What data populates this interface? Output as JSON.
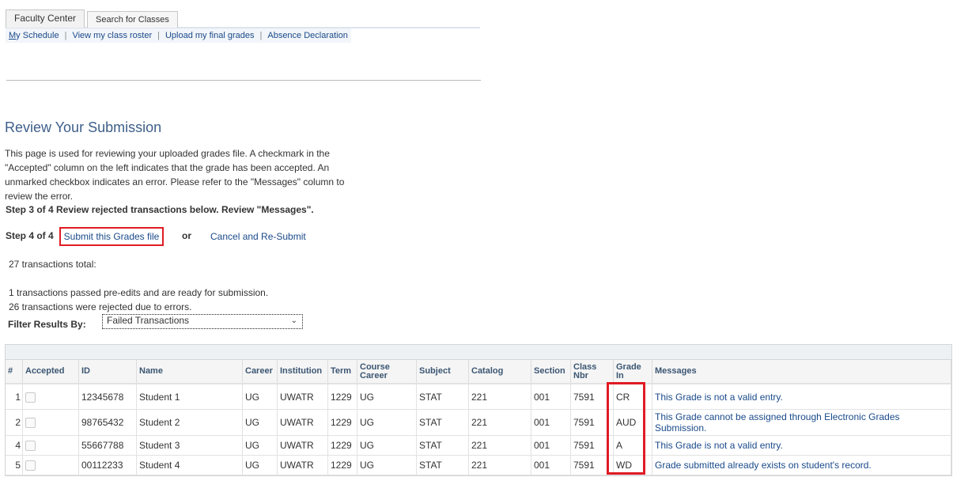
{
  "tabs": [
    {
      "label": "Faculty Center",
      "active": true
    },
    {
      "label": "Search for Classes",
      "active": false
    }
  ],
  "nav": {
    "items": [
      {
        "label_first": "M",
        "label_rest": "y Schedule"
      },
      {
        "label": "View my class roster"
      },
      {
        "label": "Upload my final grades"
      },
      {
        "label": "Absence Declaration"
      }
    ],
    "separator": "|"
  },
  "page": {
    "title": "Review Your Submission",
    "description": "This page is used for reviewing your uploaded grades file. A checkmark in the \"Accepted\" column on the left indicates that the grade has been accepted. An unmarked checkbox indicates an error. Please refer to the \"Messages\" column to review the error.",
    "step3": "Step 3 of 4 Review rejected transactions below. Review \"Messages\".",
    "step4_label": "Step 4 of 4",
    "submit_link": "Submit this Grades file",
    "or": "or",
    "cancel_link": "Cancel and Re-Submit",
    "total": "27 transactions total:",
    "passed": "1 transactions passed pre-edits and are ready for submission.",
    "rejected": "26 transactions were rejected due to errors.",
    "filter_label": "Filter Results By:",
    "filter_value": "Failed Transactions"
  },
  "table": {
    "headers": [
      "#",
      "Accepted",
      "ID",
      "Name",
      "Career",
      "Institution",
      "Term",
      "Course Career",
      "Subject",
      "Catalog",
      "Section",
      "Class Nbr",
      "Grade In",
      "Messages"
    ],
    "rows": [
      {
        "num": "1",
        "accepted": false,
        "id": "12345678",
        "name": "Student 1",
        "career": "UG",
        "institution": "UWATR",
        "term": "1229",
        "course_career": "UG",
        "subject": "STAT",
        "catalog": "221",
        "section": "001",
        "class_nbr": "7591",
        "grade_in": "CR",
        "message": "This Grade is not a valid entry."
      },
      {
        "num": "2",
        "accepted": false,
        "id": "98765432",
        "name": "Student 2",
        "career": "UG",
        "institution": "UWATR",
        "term": "1229",
        "course_career": "UG",
        "subject": "STAT",
        "catalog": "221",
        "section": "001",
        "class_nbr": "7591",
        "grade_in": "AUD",
        "message": "This Grade cannot be assigned through Electronic Grades Submission."
      },
      {
        "num": "4",
        "accepted": false,
        "id": "55667788",
        "name": "Student 3",
        "career": "UG",
        "institution": "UWATR",
        "term": "1229",
        "course_career": "UG",
        "subject": "STAT",
        "catalog": "221",
        "section": "001",
        "class_nbr": "7591",
        "grade_in": "A",
        "message": "This Grade is not a valid entry."
      },
      {
        "num": "5",
        "accepted": false,
        "id": "00112233",
        "name": "Student 4",
        "career": "UG",
        "institution": "UWATR",
        "term": "1229",
        "course_career": "UG",
        "subject": "STAT",
        "catalog": "221",
        "section": "001",
        "class_nbr": "7591",
        "grade_in": "WD",
        "message": "Grade submitted already exists on student's record."
      }
    ]
  },
  "colors": {
    "link": "#1a4a8a",
    "highlight_box": "#e01b24",
    "title": "#3e5f8a"
  }
}
